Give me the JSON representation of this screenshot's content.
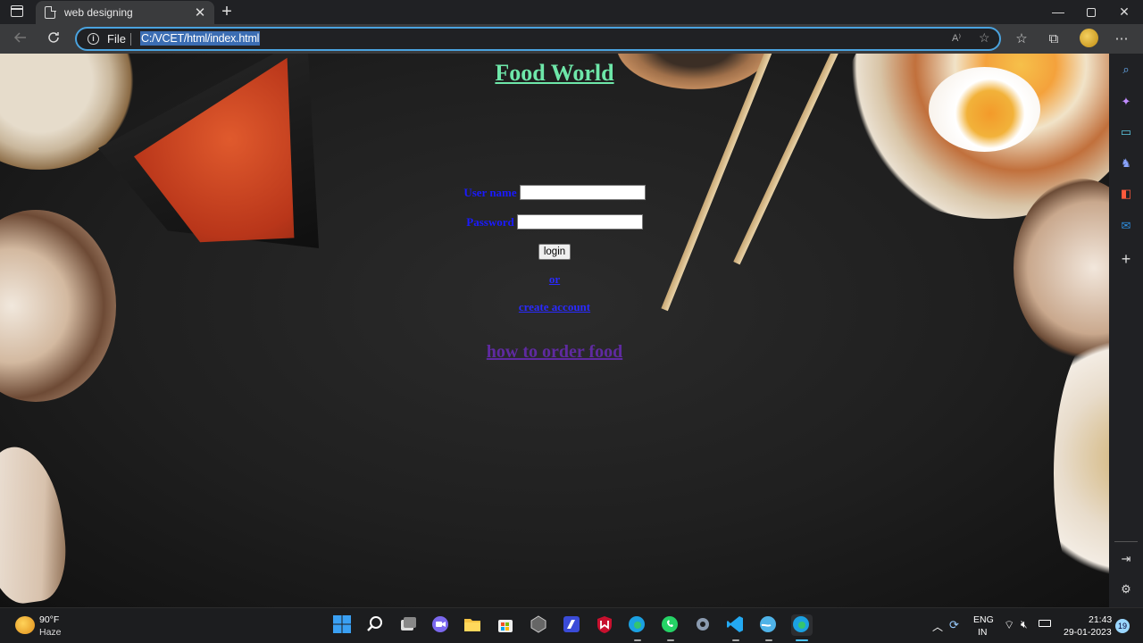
{
  "browser": {
    "tab_title": "web designing",
    "tab_close": "✕",
    "new_tab": "+",
    "protocol_label": "File",
    "url": "C:/VCET/html/index.html",
    "read_aloud": "A⁾",
    "window_minimize": "—",
    "window_close": "✕"
  },
  "page": {
    "title": "Food World",
    "username_label": "User name",
    "username_value": "",
    "password_label": "Password",
    "password_value": "",
    "login_button": "login",
    "or_text": "or",
    "create_account_link": "create account",
    "how_to_order_link": "how to order food"
  },
  "colors": {
    "title": "#6ee7a9",
    "labels": "#1a1aff",
    "links": "#2a2aff",
    "visited_link": "#5f2aa0",
    "address_focus": "#4aa3df"
  },
  "sidebar_icons": [
    "search-icon",
    "copilot-icon",
    "shopping-icon",
    "games-icon",
    "office-icon",
    "outlook-icon",
    "add-icon",
    "hide-sidebar-icon",
    "settings-icon"
  ],
  "taskbar": {
    "weather_temp": "90°F",
    "weather_condition": "Haze",
    "apps": [
      "start",
      "search",
      "task-view",
      "chat",
      "file-explorer",
      "store",
      "app",
      "powerautomate",
      "mcafee",
      "edge",
      "whatsapp",
      "settings",
      "vscode",
      "network-app",
      "edge-active"
    ],
    "language_line1": "ENG",
    "language_line2": "IN",
    "time": "21:43",
    "date": "29-01-2023",
    "notification_count": "19"
  }
}
